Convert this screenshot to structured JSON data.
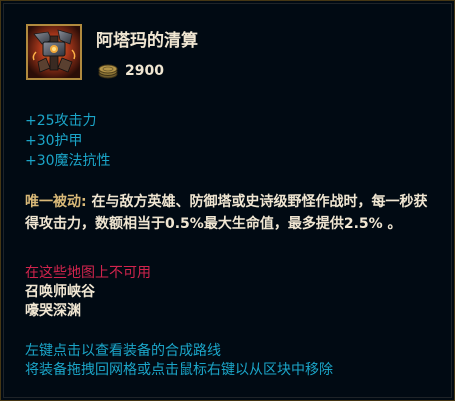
{
  "item": {
    "name": "阿塔玛的清算",
    "icon": "atmas-reckoning-item-icon",
    "price": "2900",
    "price_icon": "gold-coins-icon"
  },
  "stats": [
    "+25攻击力",
    "+30护甲",
    "+30魔法抗性"
  ],
  "passive": {
    "label": "唯一被动:",
    "text": " 在与敌方英雄、防御塔或史诗级野怪作战时，每一秒获得攻击力，数额相当于0.5%最大生命值，最多提供2.5% 。"
  },
  "availability": {
    "title": "在这些地图上不可用",
    "maps": [
      "召唤师峡谷",
      "嚎哭深渊"
    ]
  },
  "hints": [
    "左键点击以查看装备的合成路线",
    "将装备拖拽回网格或点击鼠标右键以从区块中移除"
  ],
  "colors": {
    "background": "#010a13",
    "border": "#463714",
    "stat_text": "#1ba5c8",
    "warning_text": "#d1244d",
    "passive_label": "#d9b978",
    "primary_text": "#f0e6d2"
  }
}
